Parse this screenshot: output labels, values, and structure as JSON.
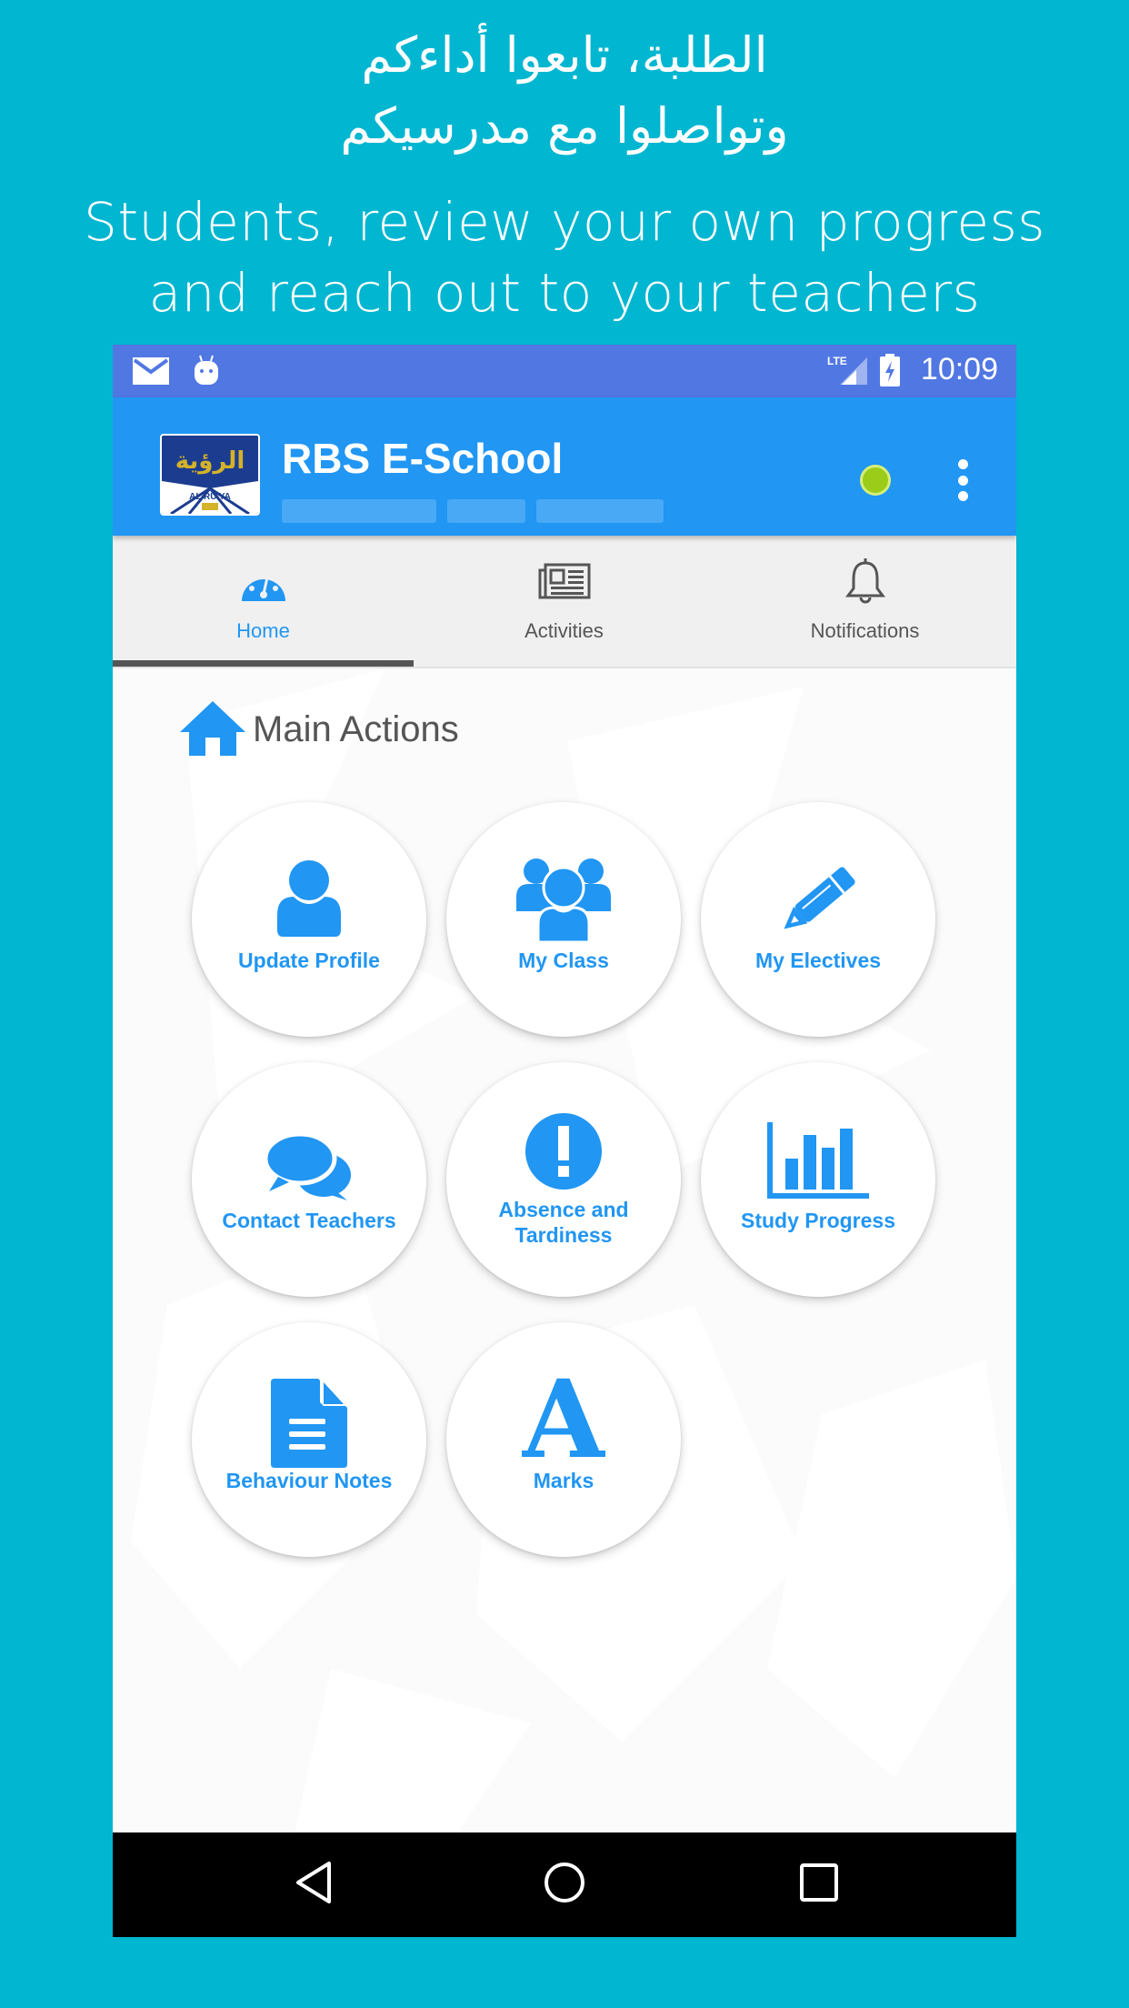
{
  "promo": {
    "arabic_line1": "الطلبة، تابعوا أداءكم",
    "arabic_line2": "وتواصلوا مع مدرسيكم",
    "english_line1": "Students, review your own progress",
    "english_line2": "and reach out to your teachers"
  },
  "status_bar": {
    "left_icons": [
      "mail-icon",
      "android-debug-icon"
    ],
    "right_icons": [
      "lte-signal-icon",
      "battery-charging-icon"
    ],
    "time": "10:09"
  },
  "app_bar": {
    "title": "RBS E-School",
    "logo_text": "الرؤية",
    "logo_sub": "AL RU'YA",
    "status_color": "#9ccc1a",
    "menu_icon": "overflow-menu-icon"
  },
  "tabs": [
    {
      "label": "Home",
      "icon": "dashboard-icon",
      "active": true
    },
    {
      "label": "Activities",
      "icon": "newspaper-icon",
      "active": false
    },
    {
      "label": "Notifications",
      "icon": "bell-icon",
      "active": false
    }
  ],
  "main": {
    "section_title": "Main Actions",
    "section_icon": "home-icon",
    "actions": [
      {
        "label": "Update Profile",
        "icon": "user-icon"
      },
      {
        "label": "My Class",
        "icon": "group-icon"
      },
      {
        "label": "My Electives",
        "icon": "pencil-icon"
      },
      {
        "label": "Contact Teachers",
        "icon": "chat-bubbles-icon"
      },
      {
        "label": "Absence and Tardiness",
        "icon": "exclamation-icon"
      },
      {
        "label": "Study Progress",
        "icon": "bar-chart-icon"
      },
      {
        "label": "Behaviour Notes",
        "icon": "document-icon"
      },
      {
        "label": "Marks",
        "icon": "letter-a-icon"
      }
    ]
  },
  "nav_bar": {
    "buttons": [
      "back",
      "home",
      "recents"
    ]
  },
  "colors": {
    "background": "#00b6d0",
    "status_bar": "#5177e3",
    "app_bar": "#2196f3",
    "accent": "#2196f3",
    "tab_bar": "#f0f0f0"
  }
}
